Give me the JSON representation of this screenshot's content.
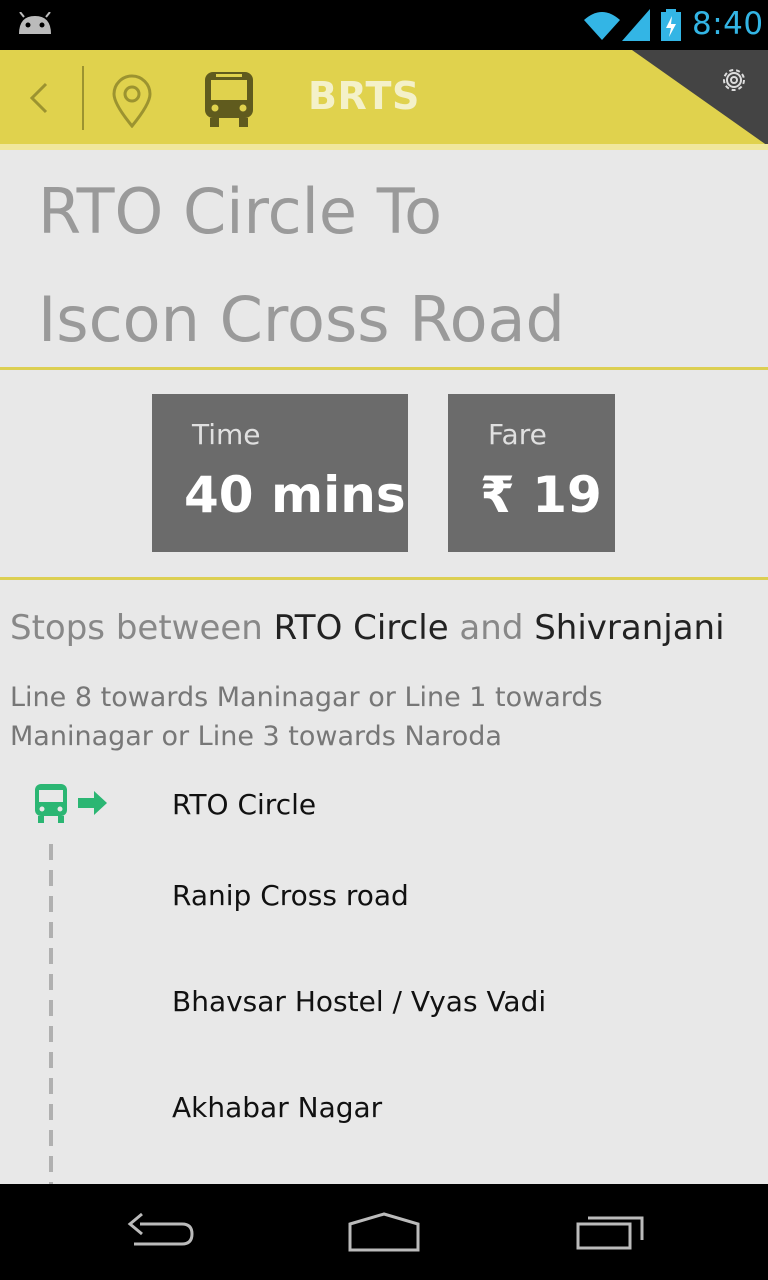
{
  "status_bar": {
    "time": "8:40",
    "icons": [
      "android-icon",
      "wifi-icon",
      "signal-icon",
      "battery-charging-icon"
    ]
  },
  "action_bar": {
    "title": "BRTS",
    "icons": [
      "back-icon",
      "location-pin-icon",
      "bus-icon",
      "settings-gear-icon"
    ],
    "accent_color": "#e0d24d"
  },
  "route": {
    "line1": "RTO Circle To",
    "line2": "Iscon Cross Road"
  },
  "info": {
    "time_label": "Time",
    "time_value": "40 mins",
    "fare_label": "Fare",
    "fare_value": "₹ 19"
  },
  "stops_header": {
    "prefix": "Stops between ",
    "from": "RTO Circle",
    "and": " and ",
    "to": "Shivranjani"
  },
  "lines_description": "Line 8 towards Maninagar or Line 1 towards Maninagar or Line 3 towards Naroda",
  "stops": [
    "RTO Circle",
    "Ranip Cross road",
    "Bhavsar Hostel / Vyas Vadi",
    "Akhabar Nagar"
  ],
  "colors": {
    "bus_stop_icon": "#2bb673",
    "info_box": "#6b6b6b",
    "divider": "#dccf52"
  },
  "nav_bar": {
    "icons": [
      "back-nav-icon",
      "home-nav-icon",
      "recent-apps-icon"
    ]
  }
}
